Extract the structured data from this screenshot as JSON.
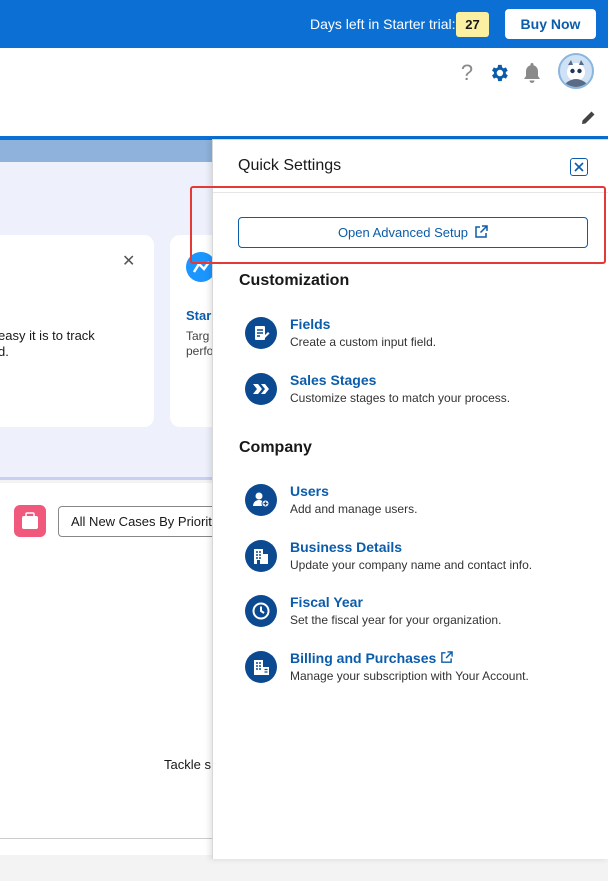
{
  "trial_bar": {
    "text": "Days left in Starter trial:",
    "days_left": "27",
    "buy_label": "Buy Now"
  },
  "header": {
    "help_glyph": "?"
  },
  "background_page": {
    "card1_close": "✕",
    "card1_line1": "easy it is to track",
    "card1_line2": "d.",
    "card2_title": "Star",
    "card2_line1": "Targ",
    "card2_line2": "perfo",
    "case_select_value": "All New Cases By Priority",
    "tackle_text": "Tackle s"
  },
  "quick_settings": {
    "title": "Quick Settings",
    "advanced_setup_label": "Open Advanced Setup",
    "sections": {
      "customization": {
        "heading": "Customization",
        "items": [
          {
            "title": "Fields",
            "desc": "Create a custom input field.",
            "icon": "fields-icon"
          },
          {
            "title": "Sales Stages",
            "desc": "Customize stages to match your process.",
            "icon": "sales-stages-icon"
          }
        ]
      },
      "company": {
        "heading": "Company",
        "items": [
          {
            "title": "Users",
            "desc": "Add and manage users.",
            "icon": "users-icon"
          },
          {
            "title": "Business Details",
            "desc": "Update your company name and contact info.",
            "icon": "building-icon"
          },
          {
            "title": "Fiscal Year",
            "desc": "Set the fiscal year for your organization.",
            "icon": "clock-icon"
          },
          {
            "title": "Billing and Purchases",
            "desc": "Manage your subscription with Your Account.",
            "icon": "billing-icon"
          }
        ]
      }
    }
  },
  "colors": {
    "brand_blue": "#0b6fd4",
    "link_blue": "#0b5cab",
    "icon_navy": "#0b4a91",
    "badge_yellow": "#fbf0a1",
    "highlight_red": "#e53935"
  }
}
